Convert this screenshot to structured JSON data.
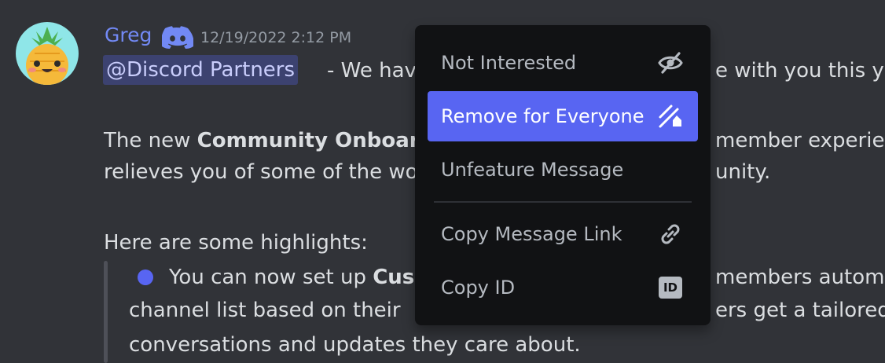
{
  "message": {
    "author": "Greg",
    "timestamp": "12/19/2022 2:12 PM",
    "mention": "@Discord Partners",
    "line1": "- We hav",
    "line1_right": "e with you this ye",
    "line2_prefix": "The new ",
    "line2_bold": "Community Onboar",
    "line2_right": "member experienc",
    "line3_left": "relieves you of some of the wo",
    "line3_right": "unity.",
    "line4": "Here are some highlights:",
    "bullet_prefix": "You can now set up ",
    "bullet_bold": "Cus",
    "bullet_right": "members automa",
    "line6_left": "channel list based on their",
    "line6_right": "ers get a tailored",
    "line7": "conversations and updates they care about."
  },
  "context_menu": {
    "items": [
      {
        "label": "Not Interested",
        "icon": "eye-slash-icon"
      },
      {
        "label": "Remove for Everyone",
        "icon": "remove-feature-icon"
      },
      {
        "label": "Unfeature Message",
        "icon": ""
      },
      {
        "label": "Copy Message Link",
        "icon": "link-icon"
      },
      {
        "label": "Copy ID",
        "icon": "id-badge-icon"
      }
    ],
    "id_badge_text": "ID"
  },
  "colors": {
    "background": "#313338",
    "menu_background": "#111214",
    "active_item": "#5865f2",
    "author": "#7289f4",
    "mention_bg": "#3c4270"
  }
}
